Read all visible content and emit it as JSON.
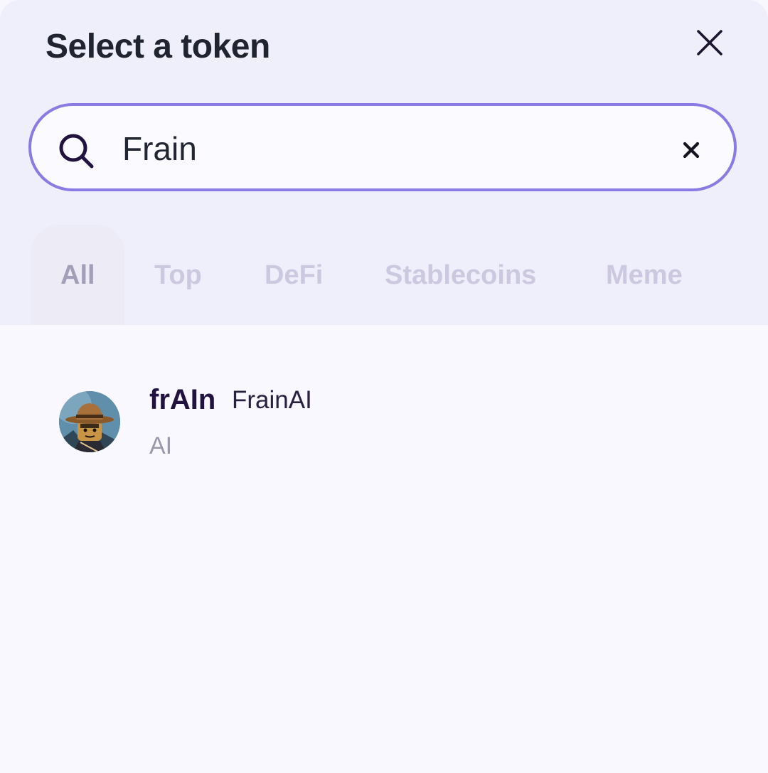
{
  "modal": {
    "title": "Select a token",
    "close_icon": "close-icon"
  },
  "search": {
    "value": "Frain",
    "search_icon": "search-icon",
    "clear_icon": "clear-icon"
  },
  "tabs": [
    {
      "label": "All",
      "active": true
    },
    {
      "label": "Top",
      "active": false
    },
    {
      "label": "DeFi",
      "active": false
    },
    {
      "label": "Stablecoins",
      "active": false
    },
    {
      "label": "Meme",
      "active": false
    }
  ],
  "results": [
    {
      "symbol": "frAIn",
      "name": "FrainAI",
      "tag": "AI",
      "avatar": "token-avatar-image"
    }
  ],
  "colors": {
    "accent": "#8a7ae3",
    "header_bg": "#efeefb",
    "list_bg": "#f9f8fe",
    "title_text": "#1f2430",
    "tab_active": "#a39fb8",
    "tab_inactive": "#cbc8df"
  }
}
